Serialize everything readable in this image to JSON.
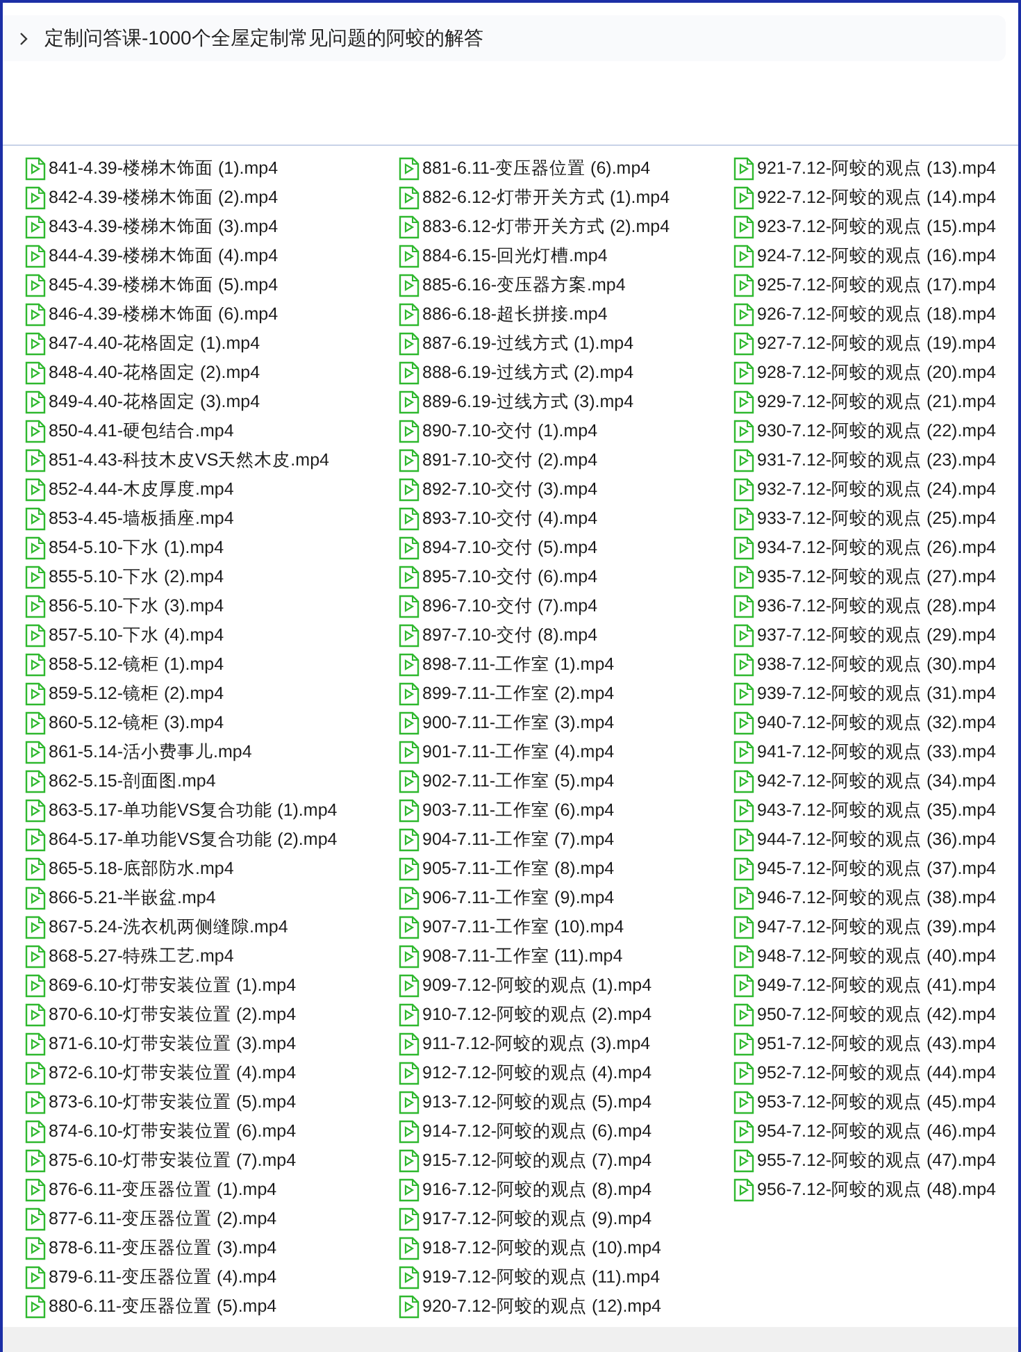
{
  "breadcrumb": {
    "title": "定制问答课-1000个全屋定制常见问题的阿蛟的解答"
  },
  "files": [
    "841-4.39-楼梯木饰面 (1).mp4",
    "842-4.39-楼梯木饰面 (2).mp4",
    "843-4.39-楼梯木饰面 (3).mp4",
    "844-4.39-楼梯木饰面 (4).mp4",
    "845-4.39-楼梯木饰面 (5).mp4",
    "846-4.39-楼梯木饰面 (6).mp4",
    "847-4.40-花格固定 (1).mp4",
    "848-4.40-花格固定 (2).mp4",
    "849-4.40-花格固定 (3).mp4",
    "850-4.41-硬包结合.mp4",
    "851-4.43-科技木皮VS天然木皮.mp4",
    "852-4.44-木皮厚度.mp4",
    "853-4.45-墙板插座.mp4",
    "854-5.10-下水 (1).mp4",
    "855-5.10-下水 (2).mp4",
    "856-5.10-下水 (3).mp4",
    "857-5.10-下水 (4).mp4",
    "858-5.12-镜柜 (1).mp4",
    "859-5.12-镜柜 (2).mp4",
    "860-5.12-镜柜 (3).mp4",
    "861-5.14-活小费事儿.mp4",
    "862-5.15-剖面图.mp4",
    "863-5.17-单功能VS复合功能 (1).mp4",
    "864-5.17-单功能VS复合功能 (2).mp4",
    "865-5.18-底部防水.mp4",
    "866-5.21-半嵌盆.mp4",
    "867-5.24-洗衣机两侧缝隙.mp4",
    "868-5.27-特殊工艺.mp4",
    "869-6.10-灯带安装位置 (1).mp4",
    "870-6.10-灯带安装位置 (2).mp4",
    "871-6.10-灯带安装位置 (3).mp4",
    "872-6.10-灯带安装位置 (4).mp4",
    "873-6.10-灯带安装位置 (5).mp4",
    "874-6.10-灯带安装位置 (6).mp4",
    "875-6.10-灯带安装位置 (7).mp4",
    "876-6.11-变压器位置 (1).mp4",
    "877-6.11-变压器位置 (2).mp4",
    "878-6.11-变压器位置 (3).mp4",
    "879-6.11-变压器位置 (4).mp4",
    "880-6.11-变压器位置 (5).mp4",
    "881-6.11-变压器位置 (6).mp4",
    "882-6.12-灯带开关方式 (1).mp4",
    "883-6.12-灯带开关方式 (2).mp4",
    "884-6.15-回光灯槽.mp4",
    "885-6.16-变压器方案.mp4",
    "886-6.18-超长拼接.mp4",
    "887-6.19-过线方式 (1).mp4",
    "888-6.19-过线方式 (2).mp4",
    "889-6.19-过线方式 (3).mp4",
    "890-7.10-交付 (1).mp4",
    "891-7.10-交付 (2).mp4",
    "892-7.10-交付 (3).mp4",
    "893-7.10-交付 (4).mp4",
    "894-7.10-交付 (5).mp4",
    "895-7.10-交付 (6).mp4",
    "896-7.10-交付 (7).mp4",
    "897-7.10-交付 (8).mp4",
    "898-7.11-工作室 (1).mp4",
    "899-7.11-工作室 (2).mp4",
    "900-7.11-工作室 (3).mp4",
    "901-7.11-工作室 (4).mp4",
    "902-7.11-工作室 (5).mp4",
    "903-7.11-工作室 (6).mp4",
    "904-7.11-工作室 (7).mp4",
    "905-7.11-工作室 (8).mp4",
    "906-7.11-工作室 (9).mp4",
    "907-7.11-工作室 (10).mp4",
    "908-7.11-工作室 (11).mp4",
    "909-7.12-阿蛟的观点 (1).mp4",
    "910-7.12-阿蛟的观点 (2).mp4",
    "911-7.12-阿蛟的观点 (3).mp4",
    "912-7.12-阿蛟的观点 (4).mp4",
    "913-7.12-阿蛟的观点 (5).mp4",
    "914-7.12-阿蛟的观点 (6).mp4",
    "915-7.12-阿蛟的观点 (7).mp4",
    "916-7.12-阿蛟的观点 (8).mp4",
    "917-7.12-阿蛟的观点 (9).mp4",
    "918-7.12-阿蛟的观点 (10).mp4",
    "919-7.12-阿蛟的观点 (11).mp4",
    "920-7.12-阿蛟的观点 (12).mp4",
    "921-7.12-阿蛟的观点 (13).mp4",
    "922-7.12-阿蛟的观点 (14).mp4",
    "923-7.12-阿蛟的观点 (15).mp4",
    "924-7.12-阿蛟的观点 (16).mp4",
    "925-7.12-阿蛟的观点 (17).mp4",
    "926-7.12-阿蛟的观点 (18).mp4",
    "927-7.12-阿蛟的观点 (19).mp4",
    "928-7.12-阿蛟的观点 (20).mp4",
    "929-7.12-阿蛟的观点 (21).mp4",
    "930-7.12-阿蛟的观点 (22).mp4",
    "931-7.12-阿蛟的观点 (23).mp4",
    "932-7.12-阿蛟的观点 (24).mp4",
    "933-7.12-阿蛟的观点 (25).mp4",
    "934-7.12-阿蛟的观点 (26).mp4",
    "935-7.12-阿蛟的观点 (27).mp4",
    "936-7.12-阿蛟的观点 (28).mp4",
    "937-7.12-阿蛟的观点 (29).mp4",
    "938-7.12-阿蛟的观点 (30).mp4",
    "939-7.12-阿蛟的观点 (31).mp4",
    "940-7.12-阿蛟的观点 (32).mp4",
    "941-7.12-阿蛟的观点 (33).mp4",
    "942-7.12-阿蛟的观点 (34).mp4",
    "943-7.12-阿蛟的观点 (35).mp4",
    "944-7.12-阿蛟的观点 (36).mp4",
    "945-7.12-阿蛟的观点 (37).mp4",
    "946-7.12-阿蛟的观点 (38).mp4",
    "947-7.12-阿蛟的观点 (39).mp4",
    "948-7.12-阿蛟的观点 (40).mp4",
    "949-7.12-阿蛟的观点 (41).mp4",
    "950-7.12-阿蛟的观点 (42).mp4",
    "951-7.12-阿蛟的观点 (43).mp4",
    "952-7.12-阿蛟的观点 (44).mp4",
    "953-7.12-阿蛟的观点 (45).mp4",
    "954-7.12-阿蛟的观点 (46).mp4",
    "955-7.12-阿蛟的观点 (47).mp4",
    "956-7.12-阿蛟的观点 (48).mp4"
  ]
}
